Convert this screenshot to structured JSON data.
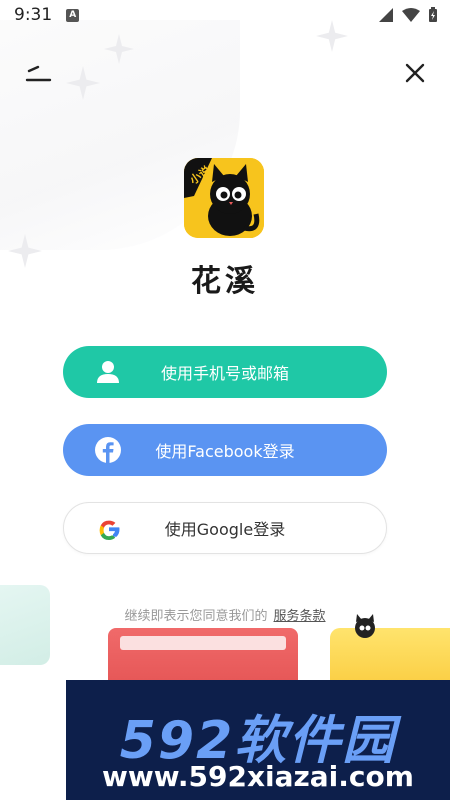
{
  "status_bar": {
    "time": "9:31",
    "notification_letter": "A"
  },
  "app": {
    "name": "花溪",
    "logo_badge": "小说"
  },
  "buttons": {
    "phone_email": "使用手机号或邮箱",
    "facebook": "使用Facebook登录",
    "google": "使用Google登录"
  },
  "terms": {
    "text": "继续即表示您同意我们的",
    "link": "服务条款"
  },
  "watermark": {
    "brand": "592软件园",
    "url": "www.592xiazai.com"
  },
  "colors": {
    "phone_button": "#1fc8a6",
    "facebook_button": "#5a94f2",
    "logo_bg": "#f7c41d",
    "watermark_bg": "#0d1f4b"
  }
}
